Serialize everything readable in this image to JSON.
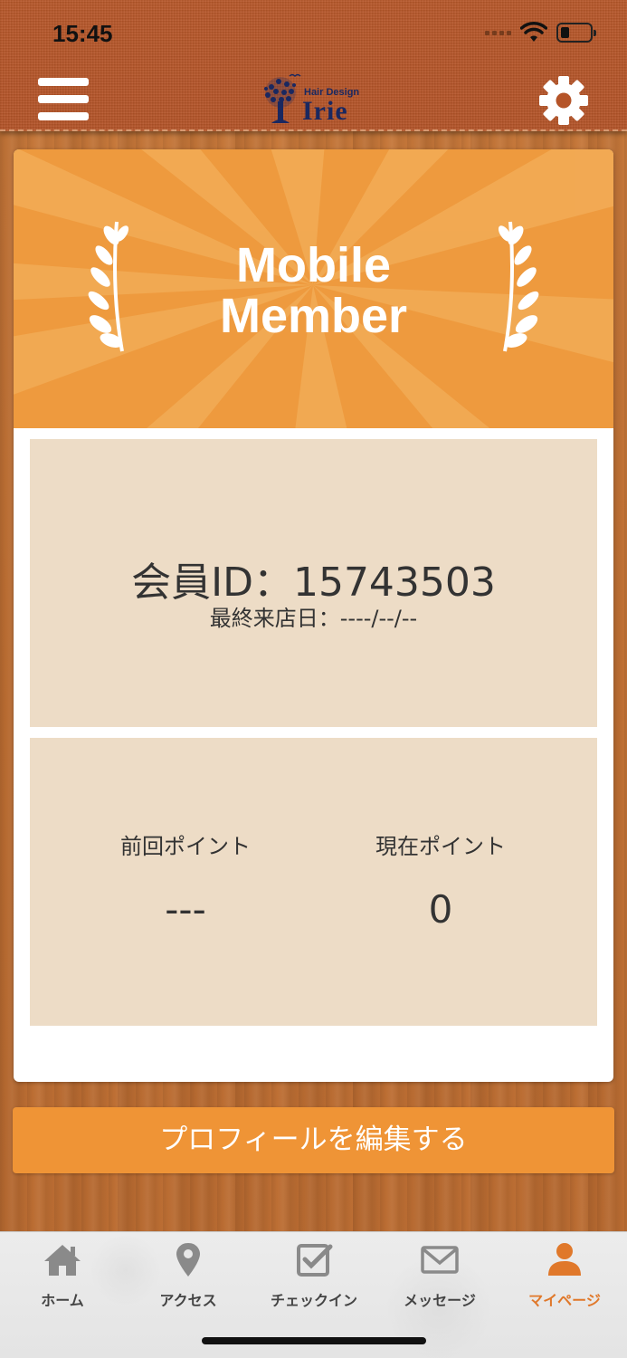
{
  "status": {
    "time": "15:45"
  },
  "header": {
    "logo_small": "Hair Design",
    "logo_big": "Irie"
  },
  "banner": {
    "line1": "Mobile",
    "line2": "Member"
  },
  "member": {
    "id_text": "会員ID：15743503",
    "last_visit": "最終来店日：----/--/--"
  },
  "points": {
    "previous_label": "前回ポイント",
    "previous_value": "---",
    "current_label": "現在ポイント",
    "current_value": "0"
  },
  "edit_button_label": "プロフィールを編集する",
  "tabs": [
    {
      "label": "ホーム",
      "icon": "home-icon"
    },
    {
      "label": "アクセス",
      "icon": "map-pin-icon"
    },
    {
      "label": "チェックイン",
      "icon": "checkin-icon"
    },
    {
      "label": "メッセージ",
      "icon": "envelope-icon"
    },
    {
      "label": "マイページ",
      "icon": "user-icon",
      "active": true
    }
  ],
  "colors": {
    "accent": "#ef9436",
    "panel": "#eddcc6",
    "header": "#b55428",
    "logo": "#1a2860"
  }
}
